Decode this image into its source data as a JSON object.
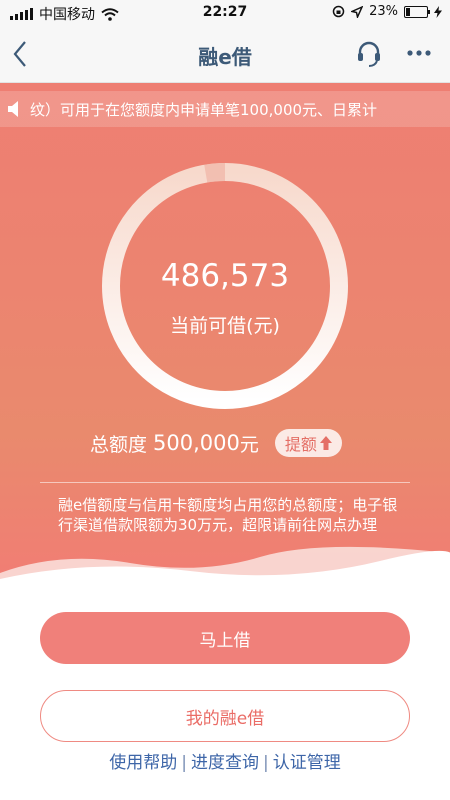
{
  "status_bar": {
    "carrier": "中国移动",
    "time": "22:27",
    "battery_text": "23%",
    "battery_level": 0.23,
    "icons": [
      "signal-icon",
      "wifi-icon",
      "orientation-lock-icon",
      "location-icon",
      "battery-icon",
      "charging-icon"
    ]
  },
  "nav": {
    "title": "融e借",
    "icons": [
      "back-chevron-icon",
      "headset-icon",
      "more-dots-icon"
    ]
  },
  "notice": {
    "text": "纹）可用于在您额度内申请单笔100,000元、日累计",
    "icon": "speaker-icon"
  },
  "loan": {
    "available_amount": "486,573",
    "available_label": "当前可借(元)",
    "total_label": "总额度",
    "total_value": "500,000",
    "total_unit": "元",
    "raise_label": "提额",
    "used_fraction": 0.027
  },
  "hint": "融e借额度与信用卡额度均占用您的总额度；电子银行渠道借款限额为30万元，超限请前往网点办理",
  "actions": {
    "borrow_now": "马上借",
    "my_loans": "我的融e借"
  },
  "links": [
    {
      "label": "使用帮助"
    },
    {
      "label": "进度查询"
    },
    {
      "label": "认证管理"
    }
  ],
  "colors": {
    "brand_red": "#f0807a",
    "nav_title": "#3d5a78",
    "link_blue": "#3e66a8"
  }
}
